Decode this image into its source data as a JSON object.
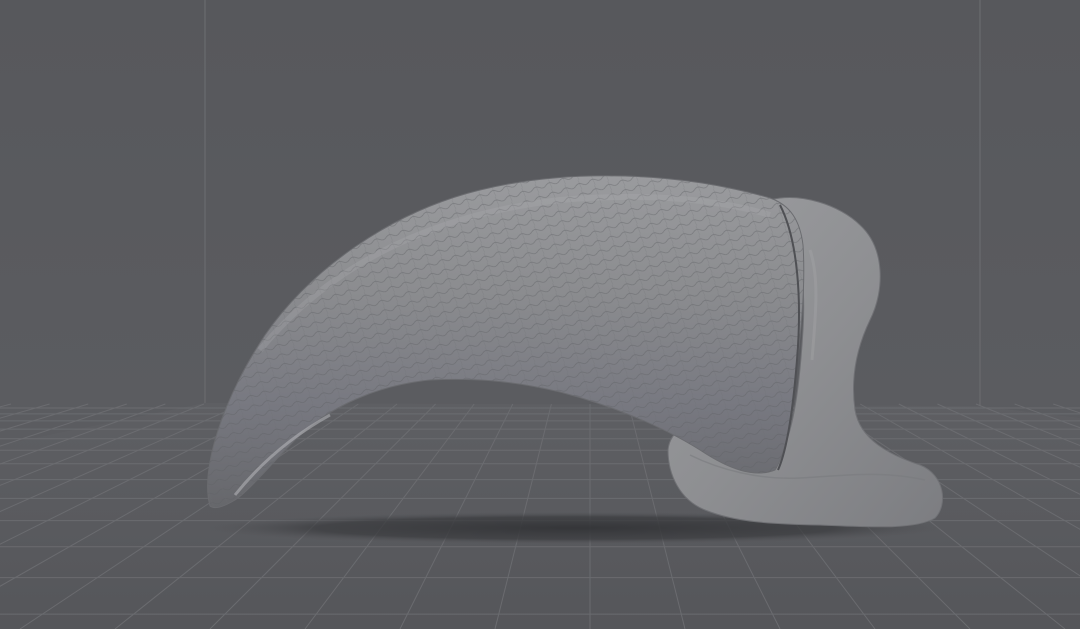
{
  "viewport": {
    "background": "#5a5b5f",
    "floor_color": "#595a5e",
    "grid_color": "#6e6f73",
    "grid_visible": true,
    "back_walls_visible": true
  },
  "model": {
    "subject": "claw",
    "surface_color": "#8a8b8e",
    "shadow_color": "#38393c"
  }
}
